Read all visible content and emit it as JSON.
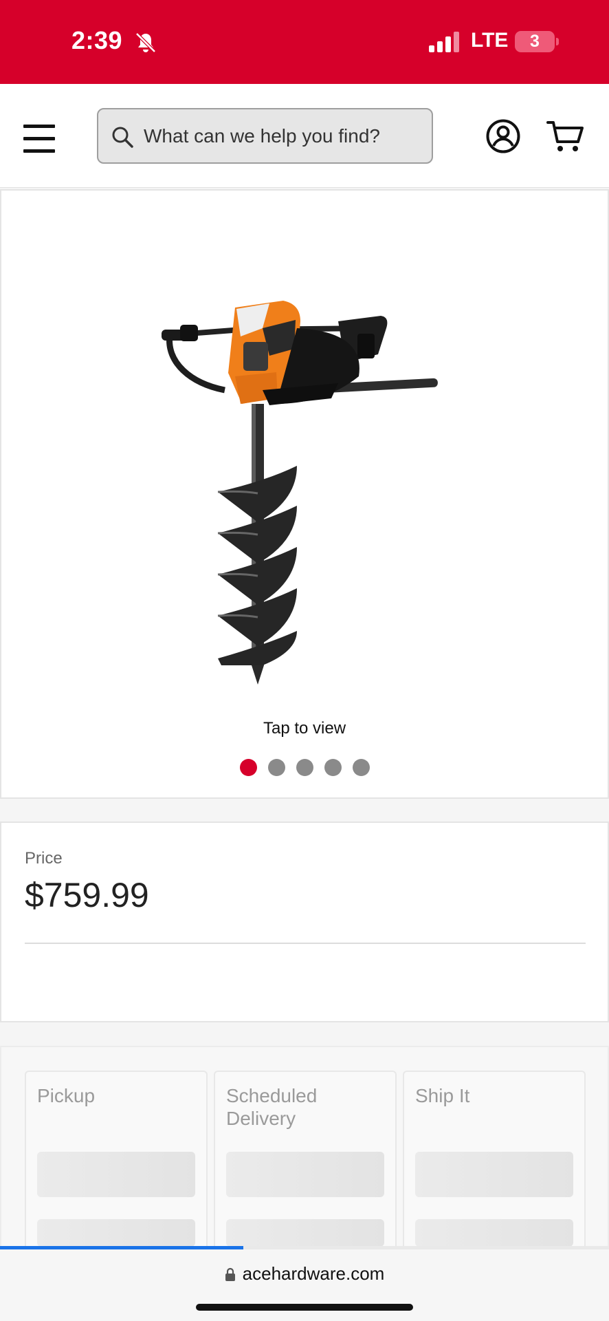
{
  "status_bar": {
    "time": "2:39",
    "network": "LTE",
    "battery_level": "3",
    "bell_icon": "bell-slash-icon",
    "signal_icon": "signal-bars-icon",
    "color": "#d6002a"
  },
  "header": {
    "menu_icon": "hamburger-menu-icon",
    "search_placeholder": "What can we help you find?",
    "search_icon": "search-icon",
    "account_icon": "account-circle-icon",
    "cart_icon": "cart-icon"
  },
  "gallery": {
    "caption": "Tap to view",
    "image_count": 5,
    "active_index": 0
  },
  "price": {
    "label": "Price",
    "value": "$759.99"
  },
  "fulfillment": {
    "options": [
      {
        "label": "Pickup"
      },
      {
        "label": "Scheduled Delivery"
      },
      {
        "label": "Ship It"
      }
    ]
  },
  "browser": {
    "url": "acehardware.com",
    "lock_icon": "lock-icon",
    "load_progress": 0.4
  },
  "colors": {
    "brand": "#d6002a",
    "progress": "#1a73e8"
  }
}
